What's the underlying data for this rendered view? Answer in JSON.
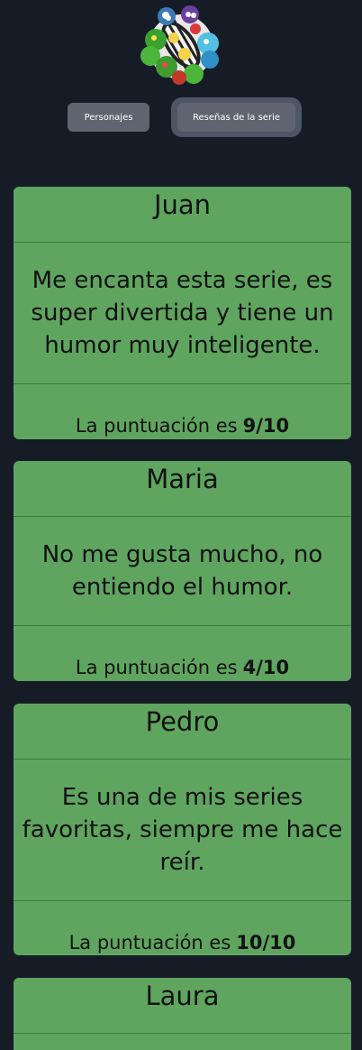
{
  "nav": {
    "characters_label": "Personajes",
    "reviews_label": "Reseñas de la serie"
  },
  "reviews": [
    {
      "name": "Juan",
      "text": "Me encanta esta serie, es super divertida y tiene un humor muy inteligente.",
      "score_label": "La puntuación es",
      "score": "9/10"
    },
    {
      "name": "Maria",
      "text": "No me gusta mucho, no entiendo el humor.",
      "score_label": "La puntuación es",
      "score": "4/10"
    },
    {
      "name": "Pedro",
      "text": "Es una de mis series favoritas, siempre me hace reír.",
      "score_label": "La puntuación es",
      "score": "10/10"
    },
    {
      "name": "Laura"
    }
  ],
  "colors": {
    "background": "#151c26",
    "card": "#5fa55f",
    "button": "#5f6470"
  }
}
